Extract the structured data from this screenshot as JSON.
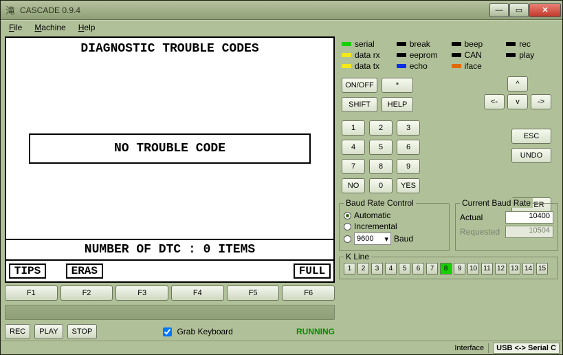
{
  "window": {
    "title": "CASCADE 0.9.4",
    "app_icon": "滝"
  },
  "menu": {
    "file": "File",
    "machine": "Machine",
    "help": "Help"
  },
  "screen": {
    "title": "DIAGNOSTIC TROUBLE CODES",
    "message": "NO TROUBLE CODE",
    "footer": "NUMBER OF DTC  :  0 ITEMS",
    "soft": {
      "f1": "TIPS",
      "f2": "ERAS",
      "f6": "FULL"
    }
  },
  "fkeys": [
    "F1",
    "F2",
    "F3",
    "F4",
    "F5",
    "F6"
  ],
  "controls": {
    "rec": "REC",
    "play": "PLAY",
    "stop": "STOP",
    "grab": "Grab Keyboard",
    "grab_checked": true,
    "status": "RUNNING"
  },
  "leds": [
    {
      "name": "serial",
      "color": "#16d000"
    },
    {
      "name": "break",
      "color": "#000000"
    },
    {
      "name": "beep",
      "color": "#000000"
    },
    {
      "name": "rec",
      "color": "#000000"
    },
    {
      "name": "data rx",
      "color": "#f3e91a"
    },
    {
      "name": "eeprom",
      "color": "#000000"
    },
    {
      "name": "CAN",
      "color": "#000000"
    },
    {
      "name": "play",
      "color": "#000000"
    },
    {
      "name": "data tx",
      "color": "#f3e91a"
    },
    {
      "name": "echo",
      "color": "#0b2fe3"
    },
    {
      "name": "iface",
      "color": "#e06a00"
    }
  ],
  "keypad": {
    "onoff": "ON/OFF",
    "star": "*",
    "shift": "SHIFT",
    "help": "HELP",
    "nums": [
      "1",
      "2",
      "3",
      "4",
      "5",
      "6",
      "7",
      "8",
      "9"
    ],
    "no": "NO",
    "zero": "0",
    "yes": "YES",
    "arrows": {
      "left": "<-",
      "up": "^",
      "right": "->",
      "down": "v"
    },
    "esc": "ESC",
    "undo": "UNDO",
    "enter": "ENTER"
  },
  "baud": {
    "title": "Baud Rate Control",
    "auto": "Automatic",
    "inc": "Incremental",
    "manual_value": "9600",
    "manual_unit": "Baud",
    "selected": "auto"
  },
  "current": {
    "title": "Current Baud Rate",
    "actual_label": "Actual",
    "actual": "10400",
    "requested_label": "Requested",
    "requested": "10504"
  },
  "kline": {
    "title": "K Line",
    "buttons": [
      "1",
      "2",
      "3",
      "4",
      "5",
      "6",
      "7",
      "8",
      "9",
      "10",
      "11",
      "12",
      "13",
      "14",
      "15"
    ],
    "active": 8
  },
  "footer": {
    "iface_label": "Interface",
    "iface_value": "USB <-> Serial C"
  }
}
